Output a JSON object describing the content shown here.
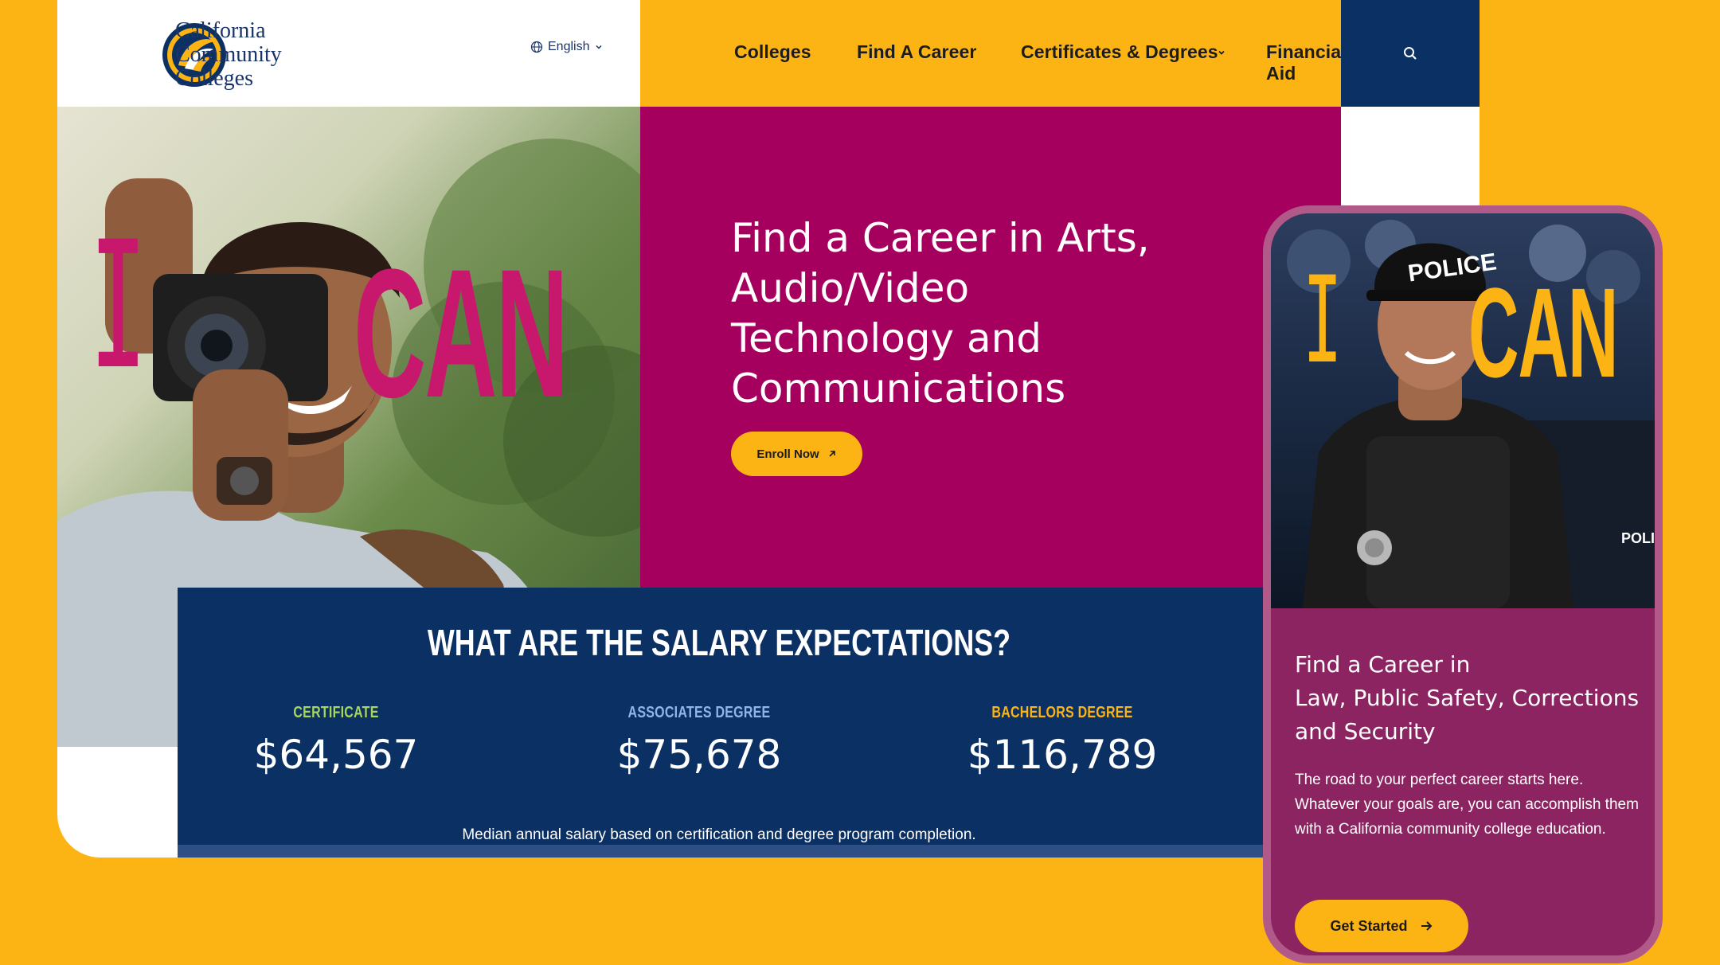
{
  "brand": {
    "name_line1": "California",
    "name_line2": "Community",
    "name_line3": "Colleges"
  },
  "language": {
    "label": "English"
  },
  "nav": {
    "items": [
      {
        "label": "Colleges"
      },
      {
        "label": "Find A Career"
      },
      {
        "label": "Certificates & Degrees"
      },
      {
        "label": "Financial Aid"
      }
    ]
  },
  "hero": {
    "overlay_i": "I",
    "overlay_can": "CAN",
    "title": "Find a Career in Arts, Audio/Video Technology and Communications",
    "cta_label": "Enroll Now"
  },
  "salary": {
    "heading": "WHAT ARE THE SALARY EXPECTATIONS?",
    "columns": [
      {
        "label": "CERTIFICATE",
        "value": "$64,567",
        "color": "#A8D55B"
      },
      {
        "label": "ASSOCIATES DEGREE",
        "value": "$75,678",
        "color": "#8FB6E8"
      },
      {
        "label": "BACHELORS DEGREE",
        "value": "$116,789",
        "color": "#FCB414"
      }
    ],
    "note": "Median annual salary based on certification and degree program completion."
  },
  "mobile": {
    "overlay_i": "I",
    "overlay_can": "CAN",
    "cap_text": "POLICE",
    "vest_text": "POLICE",
    "title_line1": "Find a Career in",
    "title_line2": "Law, Public Safety, Corrections",
    "title_line3": "and Security",
    "body": "The road to your perfect career starts here. Whatever your goals are, you can accomplish them with a California community college education.",
    "cta_label": "Get Started"
  },
  "colors": {
    "background": "#FCB414",
    "magenta": "#A5005E",
    "navy": "#0b3063",
    "mobile_panel": "#8c2461",
    "overlay_pink": "#C8186E"
  }
}
